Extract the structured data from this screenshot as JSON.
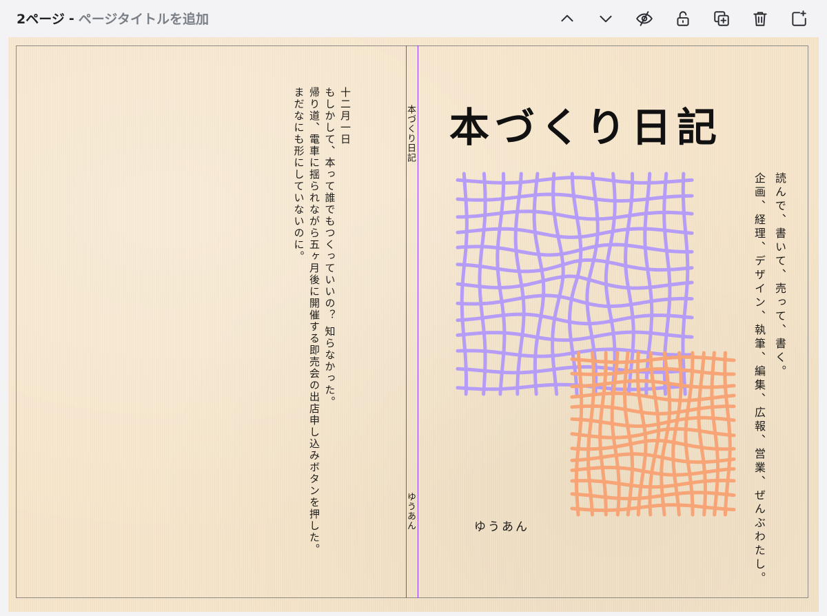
{
  "header": {
    "page_number": "2ページ",
    "separator": "-",
    "title_placeholder": "ページタイトルを追加"
  },
  "toolbar": {
    "icons": [
      "chevron-up-icon",
      "chevron-down-icon",
      "eye-off-icon",
      "unlock-icon",
      "duplicate-icon",
      "trash-icon",
      "add-page-icon"
    ]
  },
  "book": {
    "back_cover": {
      "date": "十二月一日",
      "lines": [
        "もしかして、本って誰でもつくっていいの？ 知らなかった。",
        "帰り道、電車に揺られながら五ヶ月後に開催する即売会の出店申し込みボタンを押した。",
        "まだなにも形にしていないのに。"
      ]
    },
    "spine": {
      "title": "本づくり日記",
      "author": "ゆうあん"
    },
    "front_cover": {
      "title": "本づくり日記",
      "copy_lines": [
        "読んで、書いて、売って、書く。",
        "企画、経理、デザイン、執筆、編集、広報、営業、ぜんぶわたし。"
      ],
      "author": "ゆうあん",
      "art_colors": {
        "purple": "#b49cf7",
        "orange": "#f7a476"
      }
    },
    "colors": {
      "paper": "#f7e6cb",
      "spine_guide": "#8a3cf0"
    }
  }
}
